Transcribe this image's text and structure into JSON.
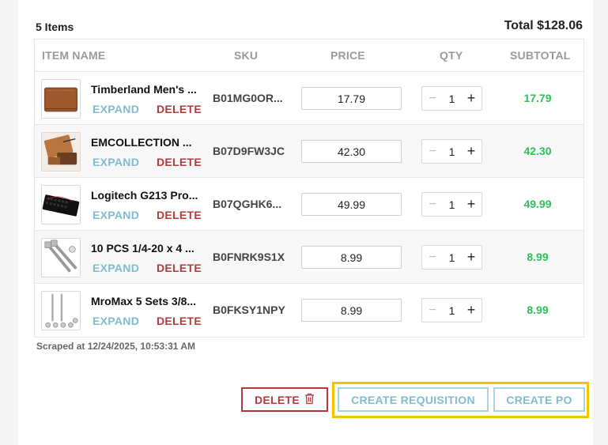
{
  "header": {
    "items_count": "5 Items",
    "total": "Total $128.06"
  },
  "columns": {
    "item_name": "ITEM NAME",
    "sku": "SKU",
    "price": "PRICE",
    "qty": "QTY",
    "subtotal": "SUBTOTAL"
  },
  "row_actions": {
    "expand": "EXPAND",
    "delete": "DELETE"
  },
  "items": [
    {
      "name": "Timberland Men's ...",
      "sku": "B01MG0OR...",
      "price": "17.79",
      "qty": "1",
      "subtotal": "17.79",
      "thumb": "wallet"
    },
    {
      "name": "EMCOLLECTION ...",
      "sku": "B07D9FW3JC",
      "price": "42.30",
      "qty": "1",
      "subtotal": "42.30",
      "thumb": "leather-set"
    },
    {
      "name": "Logitech G213 Pro...",
      "sku": "B07QGHK6...",
      "price": "49.99",
      "qty": "1",
      "subtotal": "49.99",
      "thumb": "keyboard"
    },
    {
      "name": "10 PCS 1/4-20 x 4 ...",
      "sku": "B0FNRK9S1X",
      "price": "8.99",
      "qty": "1",
      "subtotal": "8.99",
      "thumb": "bolts"
    },
    {
      "name": "MroMax 5 Sets 3/8...",
      "sku": "B0FKSY1NPY",
      "price": "8.99",
      "qty": "1",
      "subtotal": "8.99",
      "thumb": "rods"
    }
  ],
  "footer": {
    "scraped": "Scraped at 12/24/2025, 10:53:31 AM"
  },
  "actions": {
    "delete": "DELETE",
    "create_requisition": "CREATE REQUISITION",
    "create_po": "CREATE PO"
  },
  "colors": {
    "accent": "#7fbcd0",
    "danger": "#b33a3a",
    "success": "#2ec05a",
    "highlight": "#f5c400"
  },
  "icons": {
    "delete_button": "trash-icon",
    "qty_decrement": "minus-icon",
    "qty_increment": "plus-icon"
  }
}
